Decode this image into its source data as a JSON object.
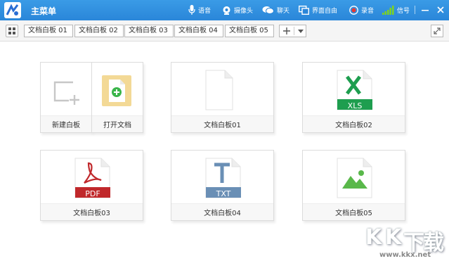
{
  "titlebar": {
    "title": "主菜单",
    "items": {
      "voice": "语音",
      "camera": "摄像头",
      "chat": "聊天",
      "screen": "界面自由",
      "record": "录音",
      "signal": "信号"
    }
  },
  "tabs": [
    "文档白板 01",
    "文档白板 02",
    "文档白板 03",
    "文档白板 04",
    "文档白板 05"
  ],
  "cards": {
    "new_board": "新建白板",
    "open_doc": "打开文档",
    "doc1": "文档白板01",
    "doc2": "文档白板02",
    "doc3": "文档白板03",
    "doc4": "文档白板04",
    "doc5": "文档白板05"
  },
  "file_types": {
    "xls": "XLS",
    "pdf": "PDF",
    "txt": "TXT"
  },
  "watermark": {
    "chars": [
      "K",
      "K",
      "下",
      "载"
    ],
    "url": "www.kkx.net"
  },
  "colors": {
    "titlebar": "#2a86d9",
    "xls_green": "#1e9e4f",
    "pdf_red": "#c0282b",
    "txt_blue": "#6a8fb5",
    "image_green": "#59b84a",
    "open_doc_bg": "#f3d996"
  }
}
